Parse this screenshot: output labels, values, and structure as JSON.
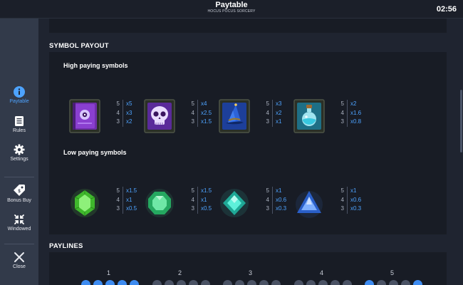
{
  "topbar": {
    "title": "Paytable",
    "subtitle": "HOCUS POCUS SORCERY",
    "clock": "02:56"
  },
  "sidebar": {
    "items": [
      {
        "label": "Paytable",
        "icon": "info-icon",
        "active": true
      },
      {
        "label": "Rules",
        "icon": "document-icon"
      },
      {
        "label": "Settings",
        "icon": "gear-icon"
      },
      {
        "label": "Bonus Buy",
        "icon": "tag-icon"
      },
      {
        "label": "Windowed",
        "icon": "collapse-arrows-icon"
      },
      {
        "label": "Close",
        "icon": "close-icon"
      }
    ]
  },
  "symbol_payout": {
    "title": "SYMBOL PAYOUT",
    "high": {
      "title": "High paying symbols",
      "symbols": [
        {
          "name": "spellbook",
          "payouts": [
            [
              "5",
              "x5"
            ],
            [
              "4",
              "x3"
            ],
            [
              "3",
              "x2"
            ]
          ]
        },
        {
          "name": "skull",
          "payouts": [
            [
              "5",
              "x4"
            ],
            [
              "4",
              "x2.5"
            ],
            [
              "3",
              "x1.5"
            ]
          ]
        },
        {
          "name": "wizard-hat",
          "payouts": [
            [
              "5",
              "x3"
            ],
            [
              "4",
              "x2"
            ],
            [
              "3",
              "x1"
            ]
          ]
        },
        {
          "name": "potion",
          "payouts": [
            [
              "5",
              "x2"
            ],
            [
              "4",
              "x1.6"
            ],
            [
              "3",
              "x0.8"
            ]
          ]
        }
      ]
    },
    "low": {
      "title": "Low paying symbols",
      "symbols": [
        {
          "name": "green-gem",
          "payouts": [
            [
              "5",
              "x1.5"
            ],
            [
              "4",
              "x1"
            ],
            [
              "3",
              "x0.5"
            ]
          ]
        },
        {
          "name": "emerald-gem",
          "payouts": [
            [
              "5",
              "x1.5"
            ],
            [
              "4",
              "x1"
            ],
            [
              "3",
              "x0.5"
            ]
          ]
        },
        {
          "name": "teal-gem",
          "payouts": [
            [
              "5",
              "x1"
            ],
            [
              "4",
              "x0.6"
            ],
            [
              "3",
              "x0.3"
            ]
          ]
        },
        {
          "name": "blue-triangle-gem",
          "payouts": [
            [
              "5",
              "x1"
            ],
            [
              "4",
              "x0.6"
            ],
            [
              "3",
              "x0.3"
            ]
          ]
        }
      ]
    }
  },
  "paylines": {
    "title": "PAYLINES",
    "numbers": [
      "1",
      "2",
      "3",
      "4",
      "5"
    ]
  },
  "colors": {
    "accent": "#4da3ff",
    "panel": "#181c25",
    "sidebar": "#323a4a"
  }
}
